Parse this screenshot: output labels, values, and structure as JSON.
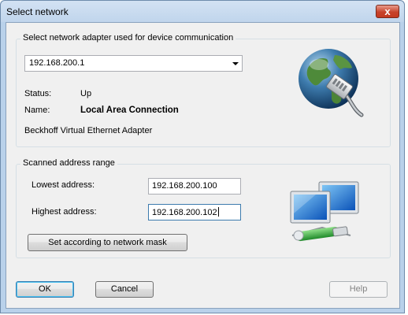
{
  "window": {
    "title": "Select network",
    "close_glyph": "x"
  },
  "adapter_group": {
    "legend": "Select network adapter used for device communication",
    "selected_adapter": "192.168.200.1",
    "status_label": "Status:",
    "status_value": "Up",
    "name_label": "Name:",
    "name_value": "Local Area Connection",
    "description": "Beckhoff Virtual Ethernet Adapter",
    "icon": "globe-network-icon"
  },
  "range_group": {
    "legend": "Scanned address range",
    "lowest_label": "Lowest address:",
    "lowest_value": "192.168.200.100",
    "highest_label": "Highest address:",
    "highest_value": "192.168.200.102",
    "mask_button": "Set according to network mask",
    "icon": "network-computers-icon"
  },
  "buttons": {
    "ok": "OK",
    "cancel": "Cancel",
    "help": "Help"
  },
  "colors": {
    "window_frame": "#b9d1ea",
    "close_button": "#c7432b",
    "dialog_background": "#f0f0f0",
    "focus_border": "#3d7bad"
  }
}
